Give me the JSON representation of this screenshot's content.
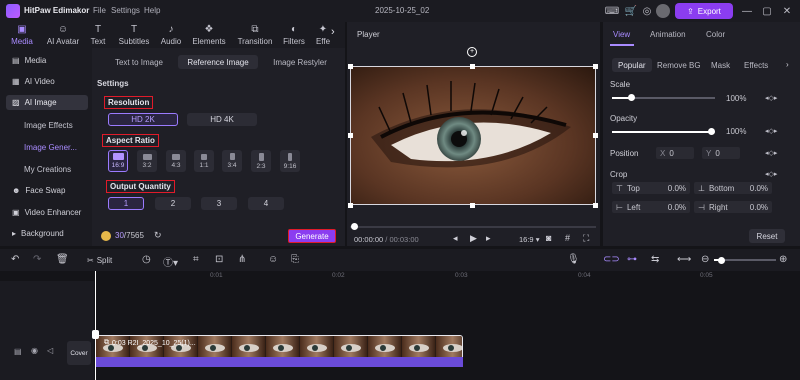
{
  "titlebar": {
    "app_name": "HitPaw Edimakor",
    "menus": [
      "File",
      "Settings",
      "Help"
    ],
    "project_name": "2025-10-25_02",
    "export_label": "Export"
  },
  "toolbar": {
    "tabs": [
      {
        "label": "Media",
        "icon": "media-icon"
      },
      {
        "label": "AI Avatar",
        "icon": "avatar-icon"
      },
      {
        "label": "Text",
        "icon": "text-icon"
      },
      {
        "label": "Subtitles",
        "icon": "subtitles-icon"
      },
      {
        "label": "Audio",
        "icon": "audio-icon"
      },
      {
        "label": "Elements",
        "icon": "elements-icon"
      },
      {
        "label": "Transition",
        "icon": "transition-icon"
      },
      {
        "label": "Filters",
        "icon": "filters-icon"
      },
      {
        "label": "Effe",
        "icon": "effects-icon"
      }
    ]
  },
  "sidebar": {
    "items": [
      "Media",
      "AI Video",
      "AI Image",
      "Face Swap",
      "Video Enhancer",
      "Background"
    ],
    "sub_items": [
      "Image Effects",
      "Image Gener...",
      "My Creations"
    ]
  },
  "ai_image": {
    "subtabs": [
      "Text to Image",
      "Reference Image",
      "Image Restyler"
    ],
    "settings_label": "Settings",
    "resolution": {
      "label": "Resolution",
      "options": [
        "HD 2K",
        "HD 4K"
      ],
      "selected": "HD 2K"
    },
    "aspect_ratio": {
      "label": "Aspect Ratio",
      "options": [
        "16:9",
        "3:2",
        "4:3",
        "1:1",
        "3:4",
        "2:3",
        "9:16"
      ],
      "selected": "16:9"
    },
    "output_quantity": {
      "label": "Output Quantity",
      "options": [
        "1",
        "2",
        "3",
        "4"
      ],
      "selected": "1"
    },
    "credits_used": "30",
    "credits_total": "/7565",
    "generate_label": "Generate"
  },
  "player": {
    "title": "Player",
    "timecode_current": "00:00:00",
    "timecode_total": "/ 00:03:00",
    "aspect": "16:9"
  },
  "properties": {
    "tabs": [
      "View",
      "Animation",
      "Color"
    ],
    "subtabs": [
      "Popular",
      "Remove BG",
      "Mask",
      "Effects"
    ],
    "scale_label": "Scale",
    "scale_value": "100%",
    "scale_level": 1.0,
    "opacity_label": "Opacity",
    "opacity_value": "100%",
    "opacity_level": 1.0,
    "position_label": "Position",
    "pos_x_label": "X",
    "pos_x_value": "0",
    "pos_y_label": "Y",
    "pos_y_value": "0",
    "crop_label": "Crop",
    "crop": {
      "top_label": "Top",
      "top_value": "0.0%",
      "bottom_label": "Bottom",
      "bottom_value": "0.0%",
      "left_label": "Left",
      "left_value": "0.0%",
      "right_label": "Right",
      "right_value": "0.0%"
    },
    "reset_label": "Reset"
  },
  "timeline": {
    "split_label": "Split",
    "ruler_ticks": [
      "0:01",
      "0:02",
      "0:03",
      "0:04",
      "0:05"
    ],
    "cover_label": "Cover",
    "clip_label": "0:03 R2I_2025_10_25(1)..."
  },
  "colors": {
    "accent": "#8b3df0",
    "highlight": "#a98bff",
    "annotation_red": "#e01b2a"
  }
}
